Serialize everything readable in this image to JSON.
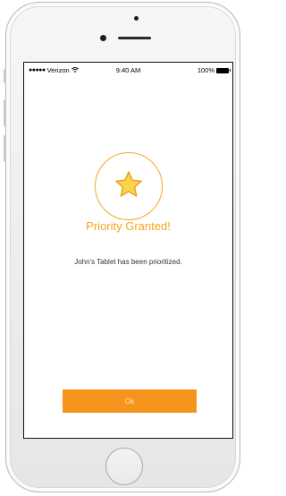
{
  "status_bar": {
    "signal_dots": "●●●●●",
    "carrier": "Verizon",
    "wifi_icon": "wifi-icon",
    "time": "9:40 AM",
    "battery_percent": "100%",
    "battery_icon": "battery-icon"
  },
  "dialog": {
    "icon": "star-icon",
    "title": "Priority Granted!",
    "message": "John's Tablet has been prioritized.",
    "ok_label": "Ok"
  },
  "colors": {
    "accent": "#f5a623",
    "button": "#f7941d",
    "star_fill": "#fbd34d"
  }
}
